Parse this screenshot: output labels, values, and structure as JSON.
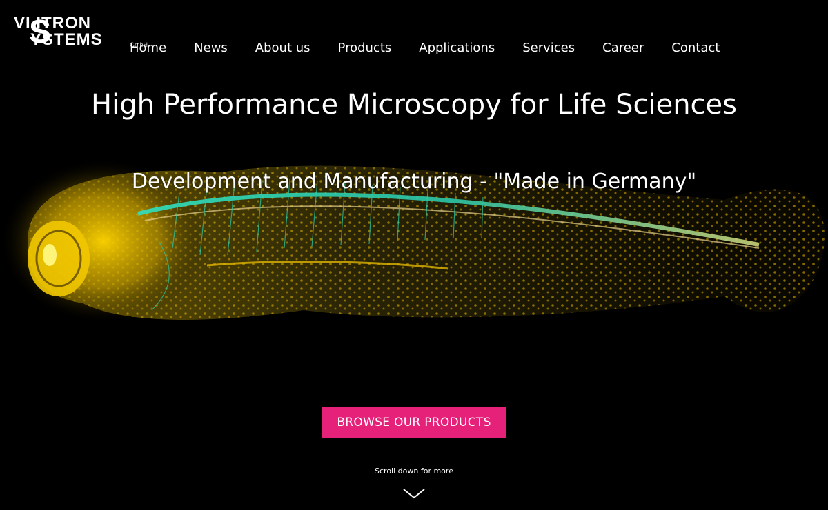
{
  "brand": {
    "line1": "VI ITRON",
    "big_letter": "S",
    "line2": "YSTEMS",
    "suffix": "GmbH"
  },
  "nav": {
    "items": [
      "Home",
      "News",
      "About us",
      "Products",
      "Applications",
      "Services",
      "Career",
      "Contact"
    ]
  },
  "hero": {
    "title": "High Performance Microscopy for Life Sciences",
    "subtitle": "Development and Manufacturing - \"Made in Germany\"",
    "image_icon": "zebrafish-fluorescence-image"
  },
  "cta": {
    "label": "BROWSE OUR PRODUCTS",
    "color": "#e6217a"
  },
  "scroll": {
    "label": "Scroll down for more",
    "icon": "chevron-down-icon"
  }
}
